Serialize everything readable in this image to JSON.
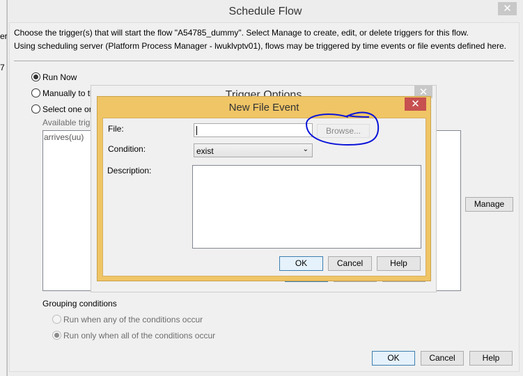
{
  "background": {
    "fragment1": "er",
    "fragment2": "7"
  },
  "main": {
    "title": "Schedule Flow",
    "line1": "Choose the trigger(s) that will start the flow \"A54785_dummy\".  Select Manage to create, edit, or delete triggers for this flow.",
    "line2": "Using scheduling server (Platform Process Manager - lwuklvptv01), flows may be triggered by time events or file events defined here.",
    "options": [
      {
        "label": "Run Now",
        "selected": true
      },
      {
        "label": "Manually to th",
        "selected": false
      },
      {
        "label": "Select one or r",
        "selected": false
      }
    ],
    "available_label": "Available trigg",
    "triggers": [
      "arrives(uu)"
    ],
    "manage": "Manage",
    "grouping_label": "Grouping conditions",
    "grouping": [
      {
        "label": "Run when any of the conditions occur",
        "selected": false
      },
      {
        "label": "Run only when all of the conditions occur",
        "selected": true
      }
    ],
    "ok": "OK",
    "cancel": "Cancel",
    "help": "Help"
  },
  "trigger_options": {
    "title": "Trigger Options"
  },
  "file_event": {
    "title": "New File Event",
    "file_label": "File:",
    "file_value": "",
    "browse": "Browse...",
    "condition_label": "Condition:",
    "condition_value": "exist",
    "description_label": "Description:",
    "description_value": "",
    "ok": "OK",
    "cancel": "Cancel",
    "help": "Help"
  },
  "colors": {
    "dialog_border": "#f0c566",
    "close_red": "#c75050",
    "annotation": "#0a14d8"
  }
}
